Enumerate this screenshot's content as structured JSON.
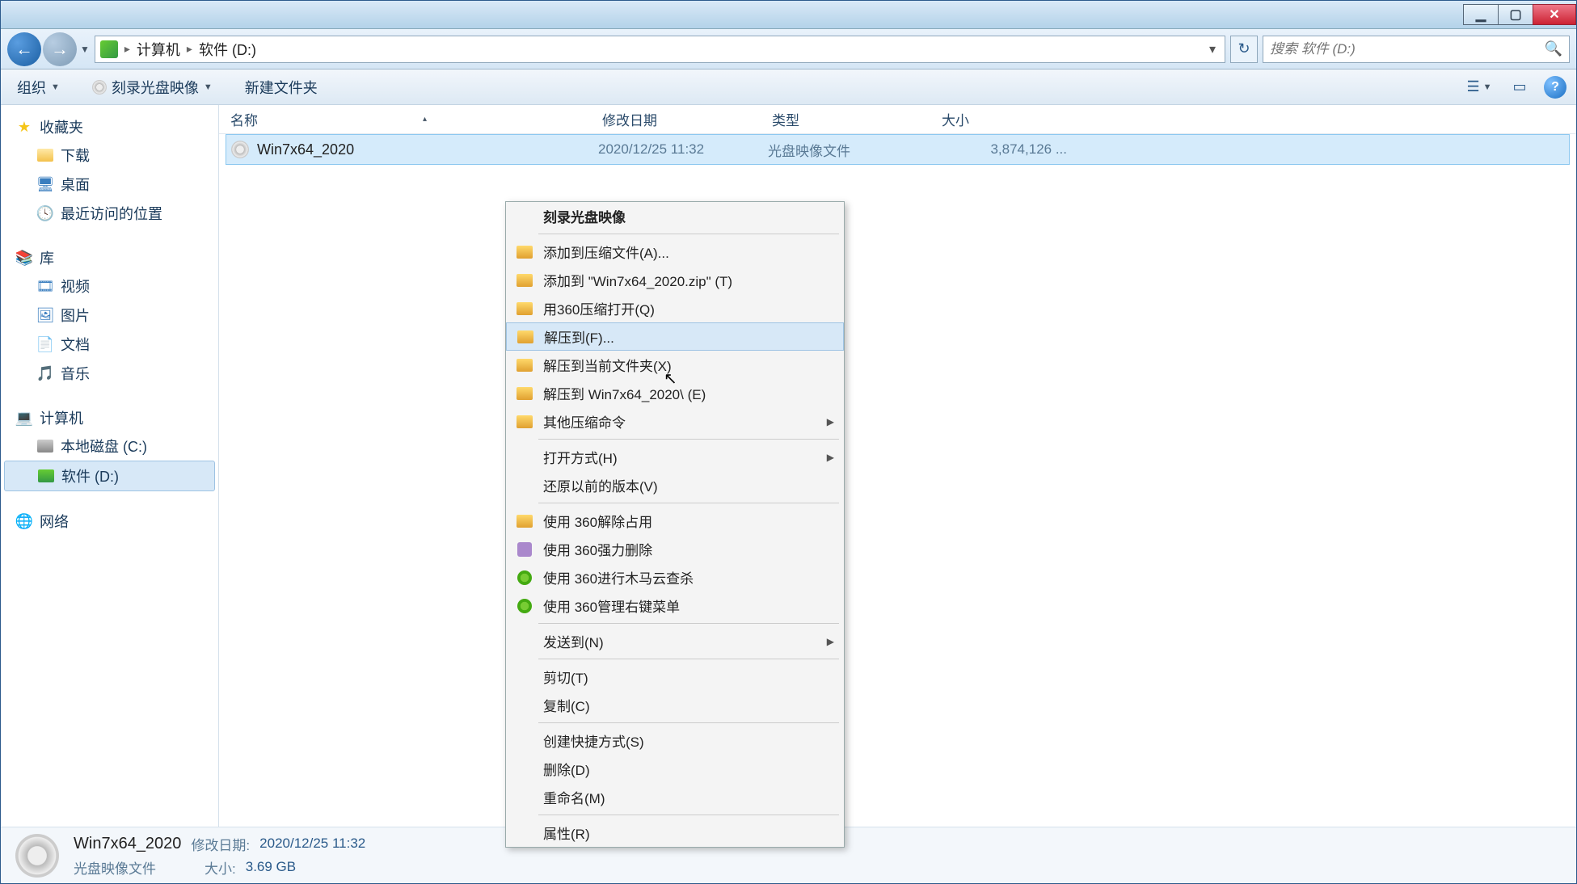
{
  "titlebar": {},
  "nav": {
    "breadcrumb": {
      "seg1": "计算机",
      "seg2": "软件 (D:)"
    },
    "search_placeholder": "搜索 软件 (D:)"
  },
  "toolbar": {
    "organize": "组织",
    "burn": "刻录光盘映像",
    "newfolder": "新建文件夹"
  },
  "sidebar": {
    "favorites": {
      "head": "收藏夹",
      "items": [
        "下载",
        "桌面",
        "最近访问的位置"
      ]
    },
    "libraries": {
      "head": "库",
      "items": [
        "视频",
        "图片",
        "文档",
        "音乐"
      ]
    },
    "computer": {
      "head": "计算机",
      "items": [
        "本地磁盘 (C:)",
        "软件 (D:)"
      ]
    },
    "network": {
      "head": "网络"
    }
  },
  "columns": {
    "name": "名称",
    "date": "修改日期",
    "type": "类型",
    "size": "大小"
  },
  "files": {
    "row0": {
      "name": "Win7x64_2020",
      "date": "2020/12/25 11:32",
      "type": "光盘映像文件",
      "size": "3,874,126 ..."
    }
  },
  "context_menu": {
    "i0": "刻录光盘映像",
    "i1": "添加到压缩文件(A)...",
    "i2": "添加到 \"Win7x64_2020.zip\" (T)",
    "i3": "用360压缩打开(Q)",
    "i4": "解压到(F)...",
    "i5": "解压到当前文件夹(X)",
    "i6": "解压到 Win7x64_2020\\ (E)",
    "i7": "其他压缩命令",
    "i8": "打开方式(H)",
    "i9": "还原以前的版本(V)",
    "i10": "使用 360解除占用",
    "i11": "使用 360强力删除",
    "i12": "使用 360进行木马云查杀",
    "i13": "使用 360管理右键菜单",
    "i14": "发送到(N)",
    "i15": "剪切(T)",
    "i16": "复制(C)",
    "i17": "创建快捷方式(S)",
    "i18": "删除(D)",
    "i19": "重命名(M)",
    "i20": "属性(R)"
  },
  "statusbar": {
    "name": "Win7x64_2020",
    "type": "光盘映像文件",
    "date_lbl": "修改日期:",
    "date_val": "2020/12/25 11:32",
    "size_lbl": "大小:",
    "size_val": "3.69 GB"
  }
}
